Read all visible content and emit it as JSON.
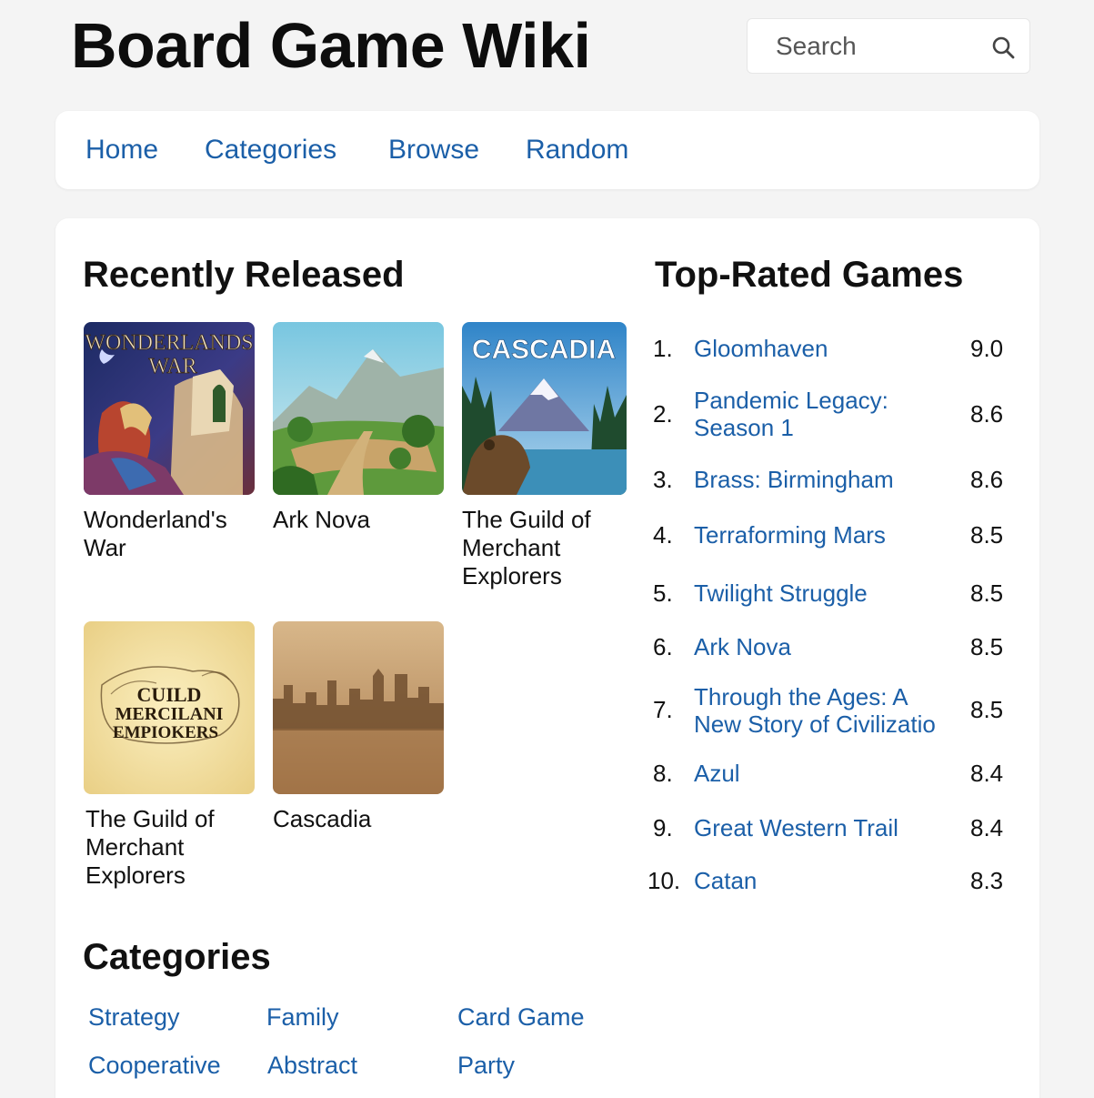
{
  "site": {
    "title": "Board Game Wiki"
  },
  "search": {
    "placeholder": "Search"
  },
  "nav": {
    "items": [
      {
        "label": "Home"
      },
      {
        "label": "Categories"
      },
      {
        "label": "Browse"
      },
      {
        "label": "Random"
      }
    ]
  },
  "recent": {
    "heading": "Recently Released",
    "games": [
      {
        "name": "Wonderland's War",
        "cover_text": "WONDERLANDS WAR",
        "cover_line1": "WONDERLANDS",
        "cover_line2": "WAR"
      },
      {
        "name": "Ark Nova"
      },
      {
        "name": "The Guild of Merchant Explorers",
        "cover_text": "CASCADIA"
      },
      {
        "name": "The Guild of Merchant Explorers",
        "cover_line1": "CUILD",
        "cover_line2": "MERCILANI",
        "cover_line3": "EMPIOKERS"
      },
      {
        "name": "Cascadia"
      }
    ]
  },
  "top_rated": {
    "heading": "Top-Rated Games",
    "games": [
      {
        "rank": "1.",
        "name": "Gloomhaven",
        "score": "9.0"
      },
      {
        "rank": "2.",
        "name": "Pandemic Legacy: Season 1",
        "score": "8.6"
      },
      {
        "rank": "3.",
        "name": "Brass: Birmingham",
        "score": "8.6"
      },
      {
        "rank": "4.",
        "name": "Terraforming Mars",
        "score": "8.5"
      },
      {
        "rank": "5.",
        "name": "Twilight Struggle",
        "score": "8.5"
      },
      {
        "rank": "6.",
        "name": "Ark Nova",
        "score": "8.5"
      },
      {
        "rank": "7.",
        "name": "Through the Ages: A New Story of Civilizatio",
        "score": "8.5"
      },
      {
        "rank": "8.",
        "name": "Azul",
        "score": "8.4"
      },
      {
        "rank": "9.",
        "name": "Great Western Trail",
        "score": "8.4"
      },
      {
        "rank": "10.",
        "name": "Catan",
        "score": "8.3"
      }
    ]
  },
  "categories": {
    "heading": "Categories",
    "items": [
      {
        "label": "Strategy"
      },
      {
        "label": "Family"
      },
      {
        "label": "Card Game"
      },
      {
        "label": "Cooperative"
      },
      {
        "label": "Abstract"
      },
      {
        "label": "Party"
      }
    ]
  },
  "colors": {
    "link": "#1b5fa8",
    "page_bg": "#f4f4f4",
    "card_bg": "#ffffff"
  }
}
